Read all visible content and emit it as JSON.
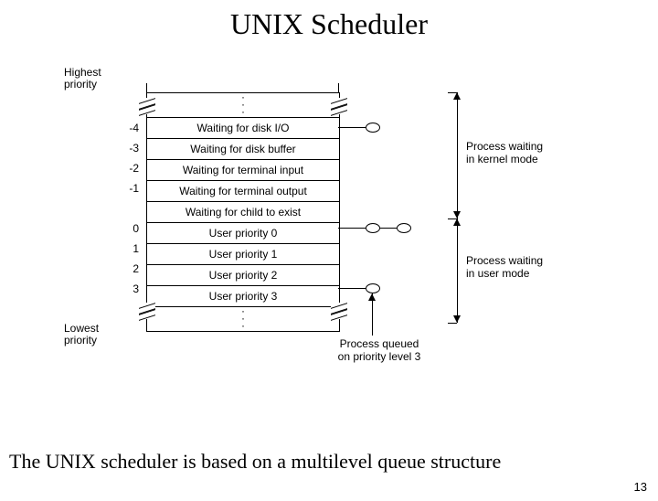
{
  "title": "UNIX Scheduler",
  "highest": "Highest\npriority",
  "lowest": "Lowest\npriority",
  "rows": [
    {
      "prio": "",
      "label": ""
    },
    {
      "prio": "-4",
      "label": "Waiting for disk I/O"
    },
    {
      "prio": "-3",
      "label": "Waiting for disk buffer"
    },
    {
      "prio": "-2",
      "label": "Waiting for terminal input"
    },
    {
      "prio": "-1",
      "label": "Waiting for terminal output"
    },
    {
      "prio": "",
      "label": "Waiting for child to exist"
    },
    {
      "prio": "0",
      "label": "User priority 0"
    },
    {
      "prio": "1",
      "label": "User priority 1"
    },
    {
      "prio": "2",
      "label": "User priority 2"
    },
    {
      "prio": "3",
      "label": "User priority 3"
    },
    {
      "prio": "",
      "label": ""
    }
  ],
  "side_kernel": "Process waiting\nin kernel mode",
  "side_user": "Process waiting\nin user mode",
  "pointer_label": "Process queued\non priority level 3",
  "caption": "The UNIX scheduler is based on a multilevel queue structure",
  "pagenum": "13"
}
